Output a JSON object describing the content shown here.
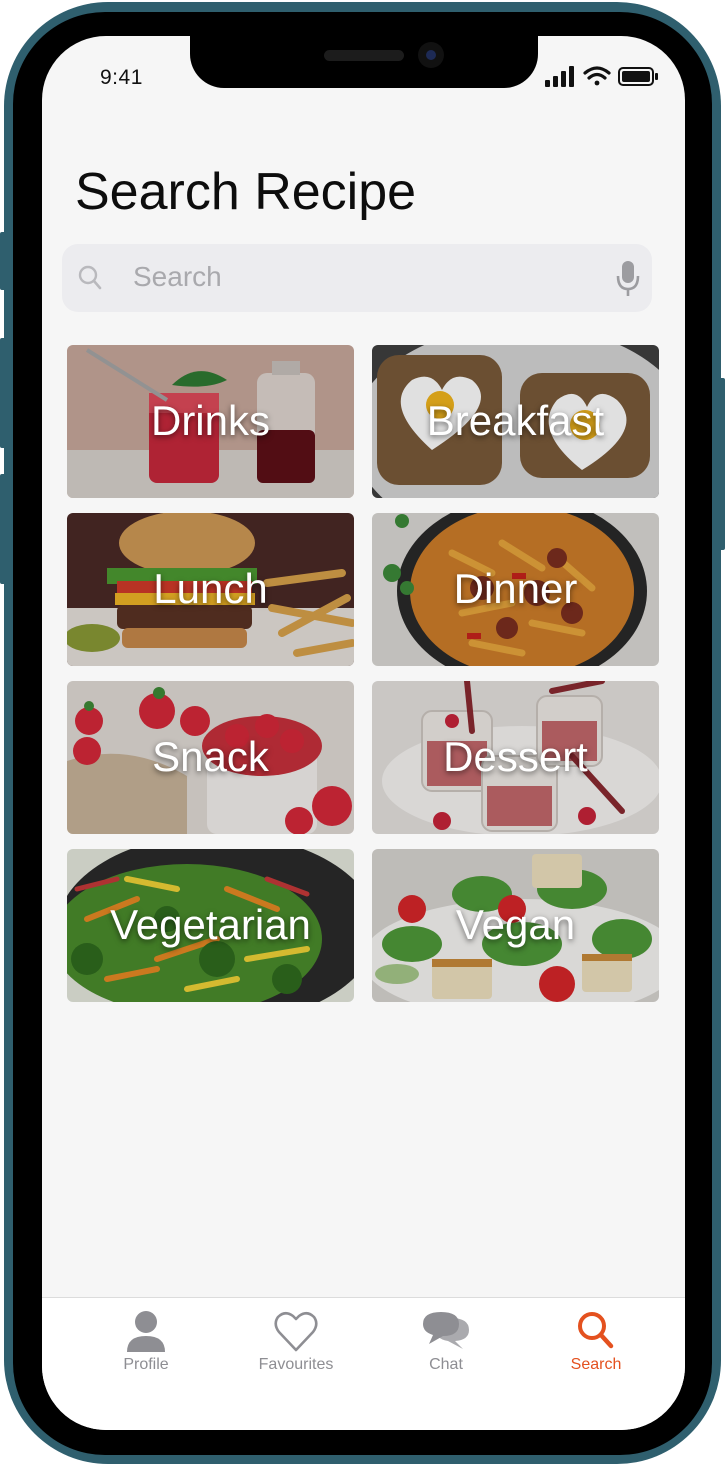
{
  "status_bar": {
    "time": "9:41"
  },
  "page": {
    "title": "Search Recipe"
  },
  "search": {
    "placeholder": "Search"
  },
  "categories": [
    {
      "label": "Drinks"
    },
    {
      "label": "Breakfast"
    },
    {
      "label": "Lunch"
    },
    {
      "label": "Dinner"
    },
    {
      "label": "Snack"
    },
    {
      "label": "Dessert"
    },
    {
      "label": "Vegetarian"
    },
    {
      "label": "Vegan"
    }
  ],
  "tabs": [
    {
      "label": "Profile",
      "icon": "person-icon",
      "active": false
    },
    {
      "label": "Favourites",
      "icon": "heart-icon",
      "active": false
    },
    {
      "label": "Chat",
      "icon": "chat-bubbles-icon",
      "active": false
    },
    {
      "label": "Search",
      "icon": "magnifier-icon",
      "active": true
    }
  ],
  "colors": {
    "accent": "#e4511f",
    "inactive": "#8e8e93",
    "frame": "#2f5f6e"
  }
}
